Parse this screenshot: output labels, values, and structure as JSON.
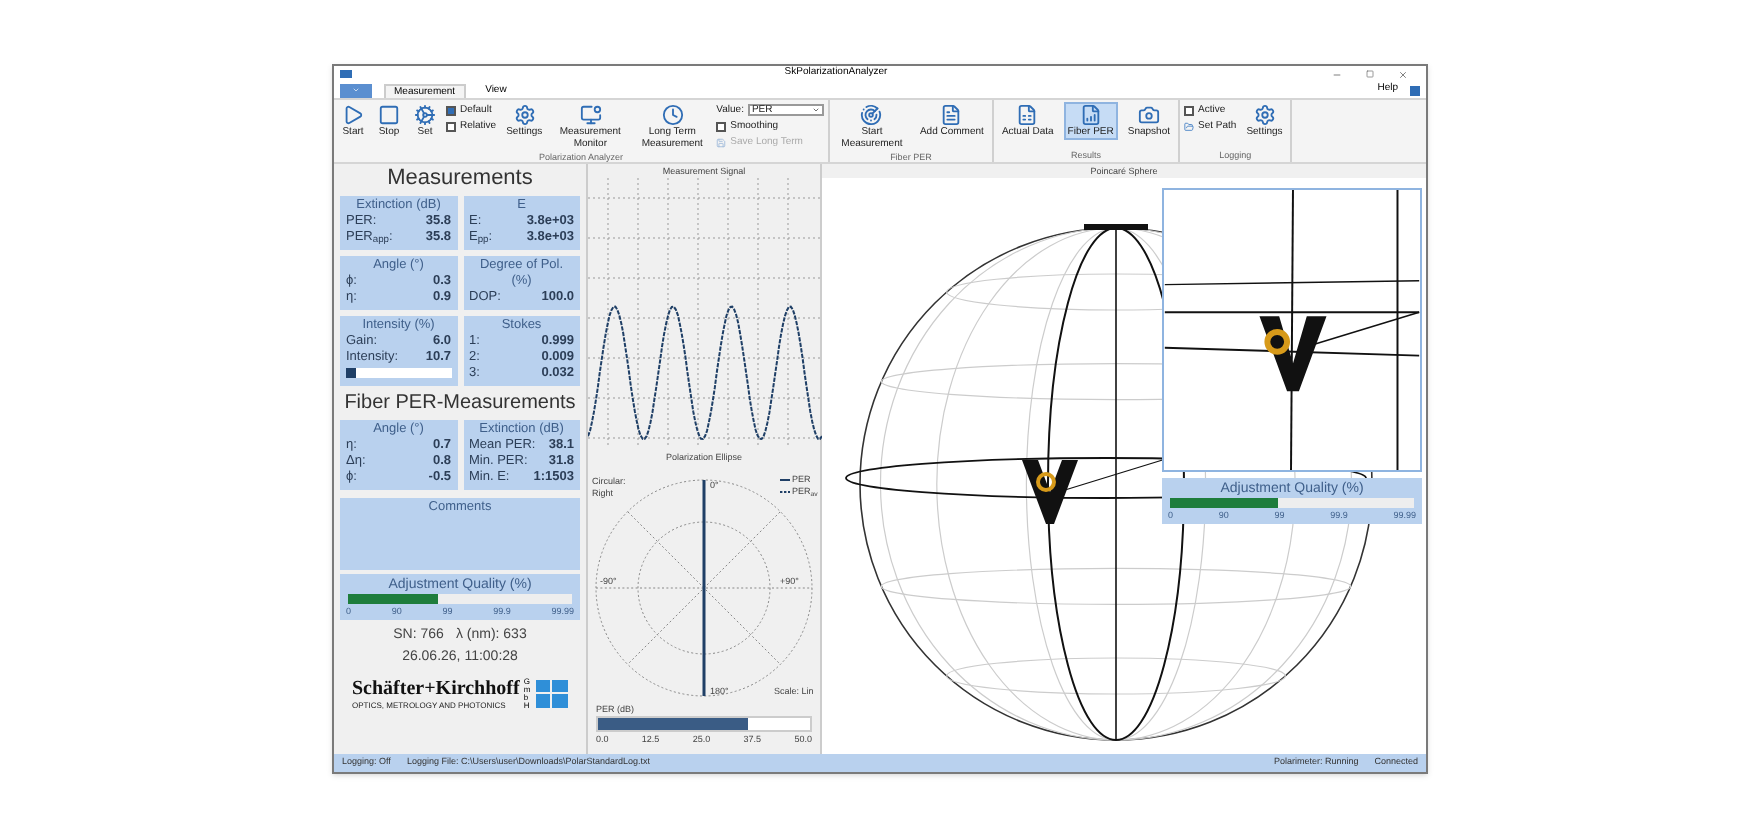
{
  "window": {
    "title": "SkPolarizationAnalyzer",
    "help": "Help"
  },
  "menu_tabs": [
    {
      "label": "Measurement",
      "selected": true
    },
    {
      "label": "View",
      "selected": false
    }
  ],
  "ribbon": [
    {
      "label": "Polarization Analyzer",
      "items": [
        {
          "kind": "button",
          "label": "Start",
          "selected": false
        },
        {
          "kind": "button",
          "label": "Stop",
          "selected": false
        },
        {
          "kind": "button",
          "label": "Set",
          "selected": false
        },
        {
          "kind": "stack",
          "items": [
            {
              "kind": "checkbox",
              "label": "Default",
              "checked": true
            },
            {
              "kind": "checkbox",
              "label": "Relative",
              "checked": false
            }
          ]
        },
        {
          "kind": "button",
          "label": "Settings",
          "selected": false
        },
        {
          "kind": "button",
          "label": "Measurement Monitor",
          "selected": false
        },
        {
          "kind": "button",
          "label": "Long Term Measurement",
          "selected": false
        },
        {
          "kind": "stack",
          "items": [
            {
              "kind": "dropdown",
              "label": "Value:",
              "value": "PER"
            },
            {
              "kind": "checkbox",
              "label": "Smoothing",
              "checked": false
            },
            {
              "kind": "link",
              "label": "Save Long Term",
              "disabled": true
            }
          ]
        }
      ]
    },
    {
      "label": "Fiber PER",
      "items": [
        {
          "kind": "button",
          "label": "Start Measurement",
          "selected": false
        },
        {
          "kind": "button",
          "label": "Add Comment",
          "selected": false
        }
      ]
    },
    {
      "label": "Results",
      "items": [
        {
          "kind": "button",
          "label": "Actual Data",
          "selected": false
        },
        {
          "kind": "button",
          "label": "Fiber PER",
          "selected": true
        },
        {
          "kind": "button",
          "label": "Snapshot",
          "selected": false
        }
      ]
    },
    {
      "label": "Logging",
      "items": [
        {
          "kind": "stack",
          "items": [
            {
              "kind": "checkbox",
              "label": "Active",
              "checked": false
            },
            {
              "kind": "link",
              "label": "Set Path",
              "disabled": false
            }
          ]
        },
        {
          "kind": "button",
          "label": "Settings",
          "selected": false
        }
      ]
    }
  ],
  "measurements": {
    "title": "Measurements",
    "cards": [
      {
        "title": "Extinction (dB)",
        "rows": [
          {
            "label": "PER:",
            "value": "35.8"
          },
          {
            "label": "PER$_{app}$:",
            "value": "35.8"
          }
        ]
      },
      {
        "title": "E",
        "rows": [
          {
            "label": "E:",
            "value": "3.8e+03"
          },
          {
            "label": "E$_{pp}$:",
            "value": "3.8e+03"
          }
        ]
      },
      {
        "title": "Angle (°)",
        "rows": [
          {
            "label": "ϕ:",
            "value": "0.3"
          },
          {
            "label": "η:",
            "value": "0.9"
          }
        ]
      },
      {
        "title": "Degree of Pol. (%)",
        "rows": [
          {
            "label": "DOP:",
            "value": "100.0"
          }
        ]
      },
      {
        "title": "Intensity (%)",
        "rows": [
          {
            "label": "Gain:",
            "value": "6.0"
          },
          {
            "label": "Intensity:",
            "value": "10.7"
          }
        ],
        "level": 0.1
      },
      {
        "title": "Stokes",
        "rows": [
          {
            "label": "1:",
            "value": "0.999"
          },
          {
            "label": "2:",
            "value": "0.009"
          },
          {
            "label": "3:",
            "value": "0.032"
          }
        ]
      }
    ]
  },
  "fiber": {
    "title": "Fiber PER-Measurements",
    "cards": [
      {
        "title": "Angle (°)",
        "rows": [
          {
            "label": "η:",
            "value": "0.7"
          },
          {
            "label": "Δη:",
            "value": "0.8"
          },
          {
            "label": "ϕ:",
            "value": "-0.5"
          }
        ]
      },
      {
        "title": "Extinction (dB)",
        "rows": [
          {
            "label": "Mean PER:",
            "value": "38.1"
          },
          {
            "label": "Min. PER:",
            "value": "31.8"
          },
          {
            "label": "Min. E:",
            "value": "1:1503"
          }
        ]
      }
    ]
  },
  "comments": {
    "title": "Comments"
  },
  "adjustment_quality": {
    "title": "Adjustment Quality (%)",
    "level": 0.4,
    "ticks": [
      "0",
      "90",
      "99",
      "99.9",
      "99.99"
    ]
  },
  "info": {
    "serial": "SN: 766",
    "wavelength": "λ (nm): 633",
    "timestamp": "26.06.26, 11:00:28"
  },
  "logo": {
    "name": "Schäfter+Kirchhoff",
    "tagline": "OPTICS, METROLOGY AND PHOTONICS",
    "suffix": "GmbH"
  },
  "signal": {
    "title": "Measurement Signal"
  },
  "ellipse": {
    "title": "Polarization Ellipse",
    "handedness_label": "Circular:",
    "handedness": "Right",
    "angles": [
      "0°",
      "-90°",
      "+90°",
      "180°"
    ],
    "legend": [
      {
        "label": "PER",
        "kind": "solid"
      },
      {
        "label": "PER$_{av}$",
        "kind": "dashed"
      }
    ],
    "scale": "Scale: Lin",
    "per_meter": {
      "label": "PER (dB)",
      "level": 0.71,
      "ticks": [
        "0.0",
        "12.5",
        "25.0",
        "37.5",
        "50.0"
      ]
    }
  },
  "sphere": {
    "title": "Poincaré Sphere",
    "adjustment_quality": {
      "title": "Adjustment Quality (%)",
      "level": 0.44,
      "ticks": [
        "0",
        "90",
        "99",
        "99.9",
        "99.99"
      ]
    }
  },
  "status_bar": {
    "left": [
      "Logging: Off",
      "Logging File: C:\\Users\\user\\Downloads\\PolarStandardLog.txt"
    ],
    "right": [
      "Polarimeter: Running",
      "Connected"
    ]
  }
}
